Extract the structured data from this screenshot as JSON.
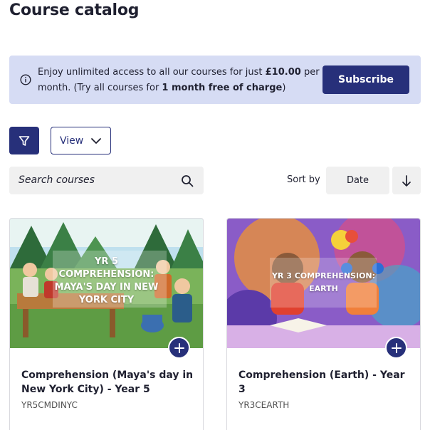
{
  "page": {
    "title": "Course catalog"
  },
  "banner": {
    "text_1": "Enjoy unlimited access to all our courses for just ",
    "price": "£10.00",
    "text_2": " per month. (Try all courses for ",
    "trial": "1 month free of charge",
    "text_3": ")",
    "subscribe_label": "Subscribe",
    "icon": "info-icon"
  },
  "toolbar": {
    "filter_icon": "filter-icon",
    "view_label": "View"
  },
  "search": {
    "placeholder": "Search courses",
    "icon": "search-icon"
  },
  "sort": {
    "label": "Sort by",
    "value": "Date",
    "direction_icon": "arrow-down-icon"
  },
  "courses": [
    {
      "thumbnail_text": "YR 5 COMPREHENSION: MAYA'S DAY IN NEW YORK CITY",
      "title": "Comprehension (Maya's day in New York City) - Year 5",
      "code": "YR5CMDINYC"
    },
    {
      "thumbnail_text": "YR 3 COMPREHENSION: EARTH",
      "title": " Comprehension (Earth) - Year 3",
      "code": "YR3CEARTH"
    }
  ],
  "colors": {
    "primary": "#27307a",
    "banner_bg": "#d6dcf4",
    "field_bg": "#f0f0f0"
  }
}
